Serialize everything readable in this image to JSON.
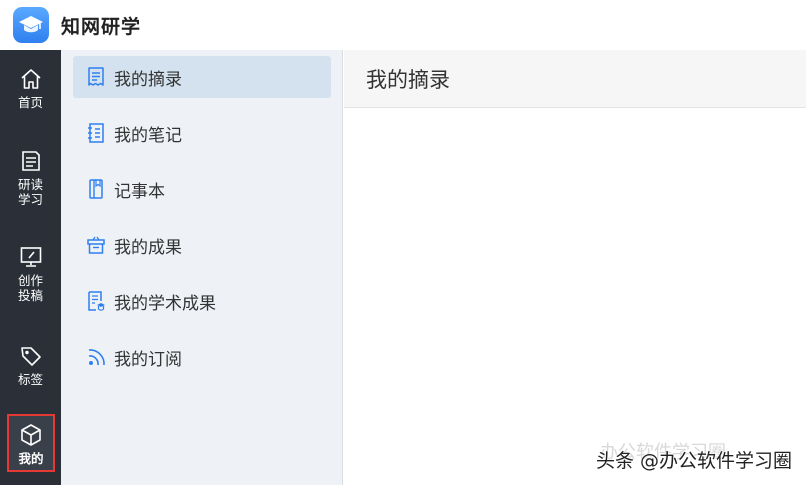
{
  "app": {
    "title": "知网研学"
  },
  "leftnav": {
    "items": [
      {
        "label": "首页",
        "icon": "home-icon"
      },
      {
        "label": "研读\n学习",
        "icon": "document-icon"
      },
      {
        "label": "创作\n投稿",
        "icon": "monitor-edit-icon"
      },
      {
        "label": "标签",
        "icon": "tag-icon"
      },
      {
        "label": "我的",
        "icon": "box-icon",
        "active": true
      }
    ]
  },
  "sidebar": {
    "items": [
      {
        "label": "我的摘录",
        "icon": "excerpt-icon",
        "active": true
      },
      {
        "label": "我的笔记",
        "icon": "notebook-icon"
      },
      {
        "label": "记事本",
        "icon": "notepad-icon"
      },
      {
        "label": "我的成果",
        "icon": "achievement-box-icon"
      },
      {
        "label": "我的学术成果",
        "icon": "academic-icon"
      },
      {
        "label": "我的订阅",
        "icon": "rss-icon"
      }
    ]
  },
  "main": {
    "header": "我的摘录"
  },
  "watermark": {
    "text": "头条 @办公软件学习圈",
    "ghost": "办公软件学习圈"
  },
  "colors": {
    "nav_bg": "#2b3038",
    "sidebar_bg": "#eef2f7",
    "active_item": "#d3e2ee",
    "icon_blue": "#2f7ff0",
    "highlight_border": "#e53935"
  }
}
